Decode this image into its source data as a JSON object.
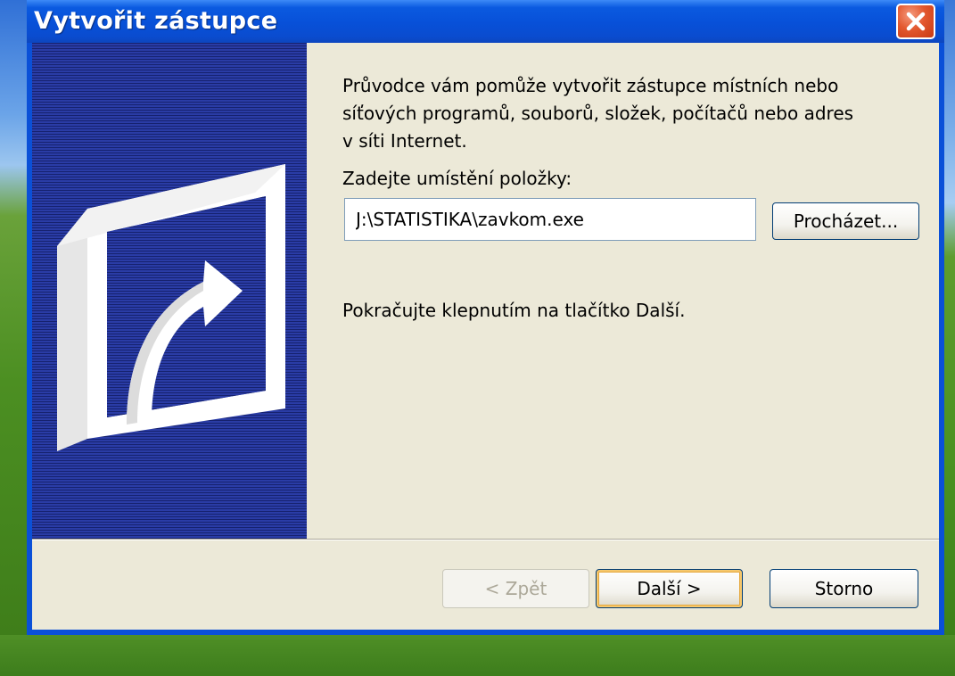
{
  "window": {
    "title": "Vytvořit zástupce",
    "close_icon": "close-icon"
  },
  "wizard": {
    "intro_text": "Průvodce vám pomůže vytvořit zástupce místních nebo\nsíťových programů, souborů, složek, počítačů nebo adres\nv síti Internet.",
    "location_label": "Zadejte umístění položky:",
    "location_value": "J:\\STATISTIKA\\zavkom.exe",
    "browse_label": "Procházet...",
    "continue_text": "Pokračujte klepnutím na tlačítko Další."
  },
  "buttons": {
    "back_label": "< Zpět",
    "back_enabled": false,
    "next_label": "Další >",
    "cancel_label": "Storno"
  },
  "side_panel": {
    "icon": "shortcut-arrow-icon"
  },
  "colors": {
    "titlebar": "#0850d8",
    "client_bg": "#ece9d8",
    "side_panel": "#1c2a86",
    "close_button": "#e3582f"
  }
}
